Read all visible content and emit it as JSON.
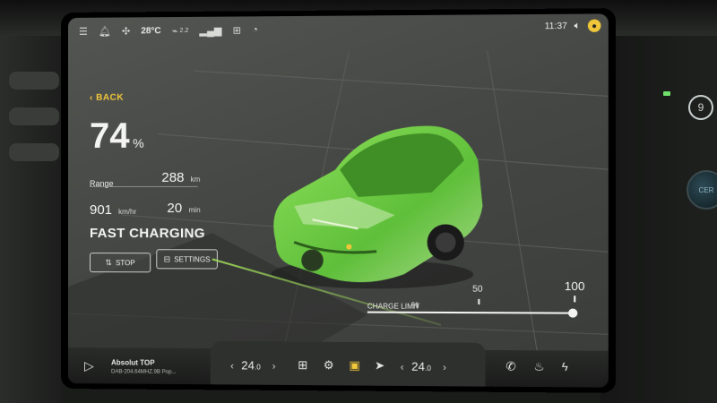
{
  "status_bar": {
    "temperature": "28°C",
    "aux_readout": "2.2",
    "time": "11:37",
    "icons": [
      "settings-sliders-icon",
      "bell-icon",
      "fan-icon",
      "battery-icon",
      "signal-icon",
      "network-icon",
      "gauge-icon",
      "volume-icon",
      "user-icon"
    ]
  },
  "nav": {
    "back_label": "BACK"
  },
  "battery": {
    "percent": "74",
    "percent_unit": "%",
    "range_label": "Range",
    "range_value": "288",
    "range_unit": "km",
    "power_value": "901",
    "power_unit": "km/hr",
    "time_value": "20",
    "time_unit": "min",
    "status": "FAST CHARGING"
  },
  "actions": {
    "stop_label": "STOP",
    "settings_label": "SETTINGS"
  },
  "charge_limit": {
    "label": "CHARGE LIMIT",
    "unit": "%",
    "mark_mid": "50",
    "mark_max": "100",
    "value_fraction": 1.0
  },
  "media": {
    "station": "Absolut TOP",
    "subtitle": "DAB-204.64MHZ.9B Pop..."
  },
  "climate": {
    "left_temp": "24",
    "left_temp_decimal": ".0",
    "right_temp": "24",
    "right_temp_decimal": ".0"
  },
  "colors": {
    "accent": "#f0c63a",
    "car_glow": "#7fcf4a",
    "text": "#f4f5f2"
  }
}
